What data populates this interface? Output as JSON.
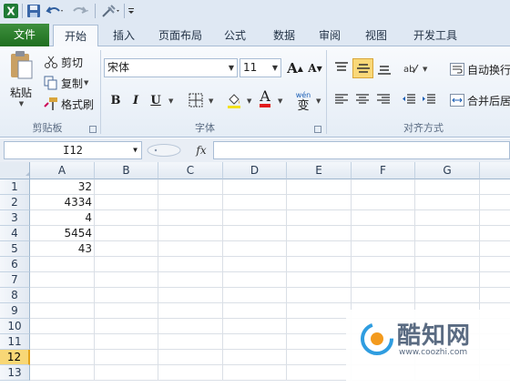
{
  "ribbon_tabs": [
    {
      "label": "文件"
    },
    {
      "label": "开始"
    },
    {
      "label": "插入"
    },
    {
      "label": "页面布局"
    },
    {
      "label": "公式"
    },
    {
      "label": "数据"
    },
    {
      "label": "审阅"
    },
    {
      "label": "视图"
    },
    {
      "label": "开发工具"
    }
  ],
  "clipboard": {
    "paste_label": "粘贴",
    "cut_label": "剪切",
    "copy_label": "复制",
    "format_painter_label": "格式刷",
    "group_label": "剪贴板"
  },
  "font": {
    "name": "宋体",
    "size": "11",
    "group_label": "字体",
    "bold": "B",
    "italic": "I",
    "underline": "U",
    "grow": "A",
    "shrink": "A",
    "font_color": "A",
    "phonetic": "wén\n变"
  },
  "alignment": {
    "wrap_text_label": "自动换行",
    "merge_label": "合并后居",
    "group_label": "对齐方式"
  },
  "formula_bar": {
    "name_box": "I12",
    "fx_label": "fx",
    "formula": ""
  },
  "sheet": {
    "columns": [
      "A",
      "B",
      "C",
      "D",
      "E",
      "F",
      "G"
    ],
    "rows": [
      "1",
      "2",
      "3",
      "4",
      "5",
      "6",
      "7",
      "8",
      "9",
      "10",
      "11",
      "12",
      "13"
    ],
    "selected_row": "12",
    "col_a_values": [
      "32",
      "4334",
      "4",
      "5454",
      "43"
    ]
  },
  "watermark": {
    "brand": "酷知网",
    "url": "www.coozhi.com"
  },
  "colors": {
    "file_tab": "#2b7d2b",
    "selected_row": "#f8d776",
    "header_bg": "#e2e9f2",
    "active_align": "#f9d878"
  }
}
